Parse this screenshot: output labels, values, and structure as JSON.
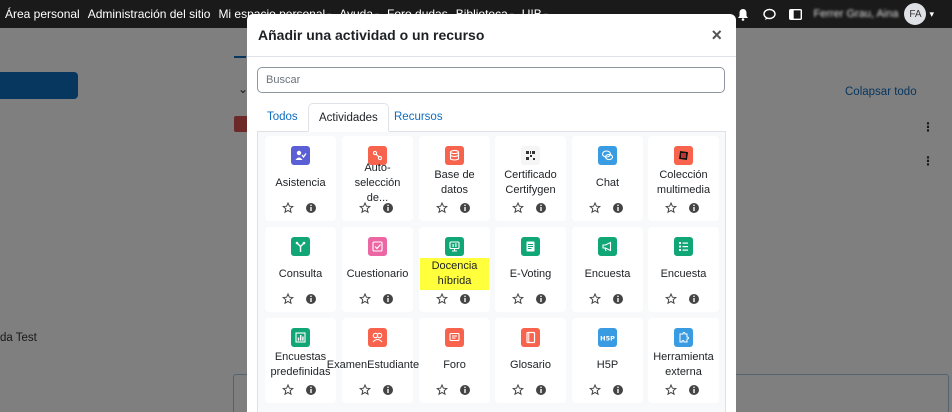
{
  "navbar": {
    "items": [
      {
        "label": "Área personal",
        "caret": false
      },
      {
        "label": "Administración del sitio",
        "caret": false
      },
      {
        "label": "Mi espacio personal",
        "caret": true
      },
      {
        "label": "Ayuda",
        "caret": true
      },
      {
        "label": "Foro dudas",
        "caret": false
      },
      {
        "label": "Biblioteca",
        "caret": true
      },
      {
        "label": "UIB",
        "caret": true
      }
    ],
    "user_name": "Ferrer Grau, Aina",
    "avatar_initials": "FA"
  },
  "background": {
    "collapse_label": "Colapsar todo",
    "test_label": "da Test"
  },
  "modal": {
    "title": "Añadir una actividad o un recurso",
    "close_symbol": "×",
    "search_placeholder": "Buscar",
    "tabs": [
      "Todos",
      "Actividades",
      "Recursos"
    ],
    "active_tab": "Actividades"
  },
  "activities": [
    {
      "name": "Asistencia",
      "icon": "attendance-icon",
      "color": "#5b5fd6"
    },
    {
      "name": "Auto-selección de...",
      "icon": "auto-selection-icon",
      "color": "#f7634d"
    },
    {
      "name": "Base de datos",
      "icon": "database-icon",
      "color": "#f7634d"
    },
    {
      "name": "Certificado Certifygen",
      "icon": "certificate-icon",
      "color": "#f5f5f5"
    },
    {
      "name": "Chat",
      "icon": "chat-icon",
      "color": "#399be2"
    },
    {
      "name": "Colección multimedia",
      "icon": "media-collection-icon",
      "color": "#f7634d"
    },
    {
      "name": "Consulta",
      "icon": "choice-icon",
      "color": "#11a676"
    },
    {
      "name": "Cuestionario",
      "icon": "quiz-icon",
      "color": "#eb66a2"
    },
    {
      "name": "Docencia híbrida",
      "icon": "hybrid-teaching-icon",
      "color": "#11a676",
      "highlight": true
    },
    {
      "name": "E-Voting",
      "icon": "evoting-icon",
      "color": "#11a676"
    },
    {
      "name": "Encuesta",
      "icon": "survey-megaphone-icon",
      "color": "#11a676"
    },
    {
      "name": "Encuesta",
      "icon": "feedback-list-icon",
      "color": "#11a676"
    },
    {
      "name": "Encuestas predefinidas",
      "icon": "predefined-surveys-icon",
      "color": "#11a676"
    },
    {
      "name": "ExamenEstudiante...",
      "icon": "student-exam-icon",
      "color": "#f7634d"
    },
    {
      "name": "Foro",
      "icon": "forum-icon",
      "color": "#f7634d"
    },
    {
      "name": "Glosario",
      "icon": "glossary-icon",
      "color": "#f7634d"
    },
    {
      "name": "H5P",
      "icon": "h5p-icon",
      "color": "#399be2"
    },
    {
      "name": "Herramienta externa",
      "icon": "external-tool-icon",
      "color": "#399be2"
    }
  ]
}
